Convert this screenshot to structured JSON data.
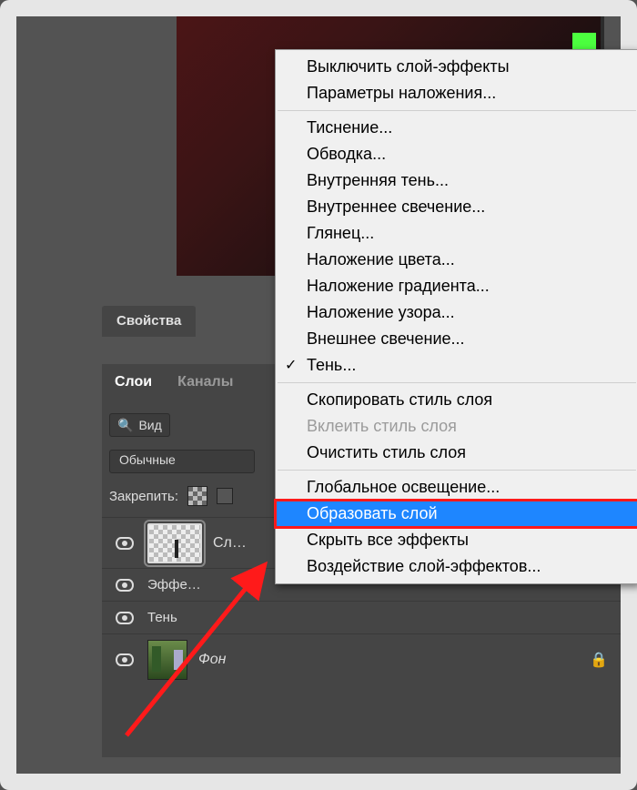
{
  "panels": {
    "properties": {
      "title": "Свойства"
    },
    "layers": {
      "tabs": {
        "layers": "Слои",
        "channels": "Каналы"
      },
      "search_label": "Вид",
      "blend_mode": "Обычные",
      "lock_label": "Закрепить:"
    }
  },
  "layers": {
    "top": {
      "name": "Сл…",
      "effects_label": "Эффе…",
      "shadow_label": "Тень"
    },
    "bg": {
      "name": "Фон"
    }
  },
  "context_menu": {
    "items": [
      {
        "label": "Выключить слой-эффекты"
      },
      {
        "label": "Параметры наложения..."
      },
      {
        "sep": true
      },
      {
        "label": "Тиснение..."
      },
      {
        "label": "Обводка..."
      },
      {
        "label": "Внутренняя тень..."
      },
      {
        "label": "Внутреннее свечение..."
      },
      {
        "label": "Глянец..."
      },
      {
        "label": "Наложение цвета..."
      },
      {
        "label": "Наложение градиента..."
      },
      {
        "label": "Наложение узора..."
      },
      {
        "label": "Внешнее свечение..."
      },
      {
        "label": "Тень...",
        "checked": true
      },
      {
        "sep": true
      },
      {
        "label": "Скопировать стиль слоя"
      },
      {
        "label": "Вклеить стиль слоя",
        "disabled": true
      },
      {
        "label": "Очистить стиль слоя"
      },
      {
        "sep": true
      },
      {
        "label": "Глобальное освещение..."
      },
      {
        "label": "Образовать слой",
        "highlight": true
      },
      {
        "label": "Скрыть все эффекты"
      },
      {
        "label": "Воздействие слой-эффектов..."
      }
    ]
  }
}
